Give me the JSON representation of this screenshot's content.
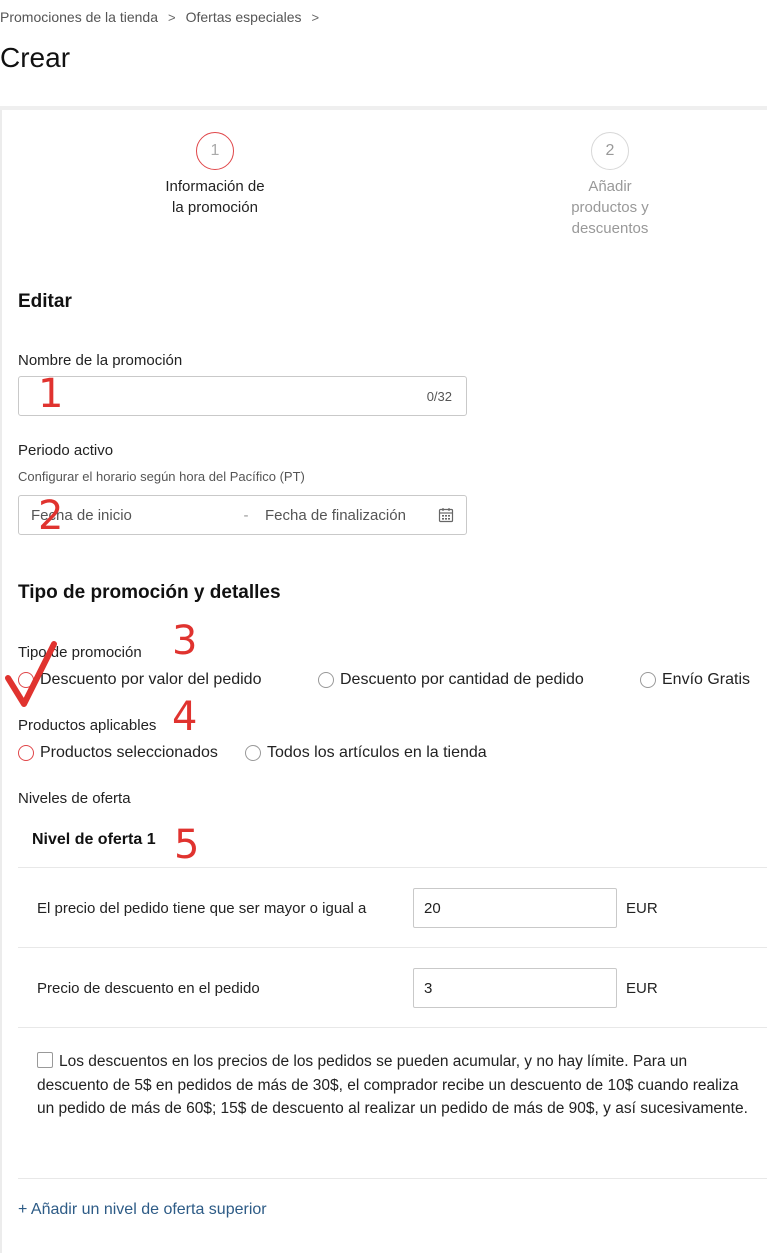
{
  "breadcrumb": {
    "items": [
      "Promociones de la tienda",
      "Ofertas especiales"
    ],
    "separator": ">"
  },
  "page_title": "Crear",
  "stepper": {
    "steps": [
      {
        "number": "1",
        "label_lines": [
          "Información de",
          "la promoción"
        ],
        "state": "active"
      },
      {
        "number": "2",
        "label_lines": [
          "Añadir",
          "productos y",
          "descuentos"
        ],
        "state": "inactive"
      }
    ]
  },
  "edit": {
    "title": "Editar",
    "promo_name": {
      "label": "Nombre de la promoción",
      "value": "",
      "counter": "0/32"
    },
    "active_period": {
      "label": "Periodo activo",
      "hint": "Configurar el horario según hora del Pacífico (PT)",
      "start_placeholder": "Fecha de inicio",
      "separator": "-",
      "end_placeholder": "Fecha de finalización",
      "icon": "calendar-icon"
    }
  },
  "promo_details": {
    "title": "Tipo de promoción y detalles",
    "promo_type": {
      "label": "Tipo de promoción",
      "options": [
        "Descuento por valor del pedido",
        "Descuento por cantidad de pedido",
        "Envío Gratis"
      ]
    },
    "applicable_products": {
      "label": "Productos aplicables",
      "options": [
        "Productos seleccionados",
        "Todos los artículos en la tienda"
      ]
    },
    "offer_levels": {
      "label": "Niveles de oferta",
      "level_title": "Nivel de oferta 1",
      "min_order": {
        "label": "El precio del pedido tiene que ser mayor o igual a",
        "value": "20",
        "unit": "EUR"
      },
      "discount": {
        "label": "Precio de descuento en el pedido",
        "value": "3",
        "unit": "EUR"
      },
      "stacking_note": "Los descuentos en los precios de los pedidos se pueden acumular, y no hay límite. Para un descuento de 5$ en pedidos de más de 30$, el comprador recibe un descuento de 10$ cuando realiza un pedido de más de 60$; 15$ de descuento al realizar un pedido de más de 90$, y así sucesivamente.",
      "add_level": "+ Añadir un nivel de oferta superior"
    }
  },
  "annotations": [
    "1",
    "2",
    "3",
    "4",
    "5"
  ],
  "colors": {
    "accent_red": "#e0474a",
    "annotation_red": "#e0332f",
    "link_blue": "#2d5b86",
    "border_gray": "#c9c9c9"
  }
}
